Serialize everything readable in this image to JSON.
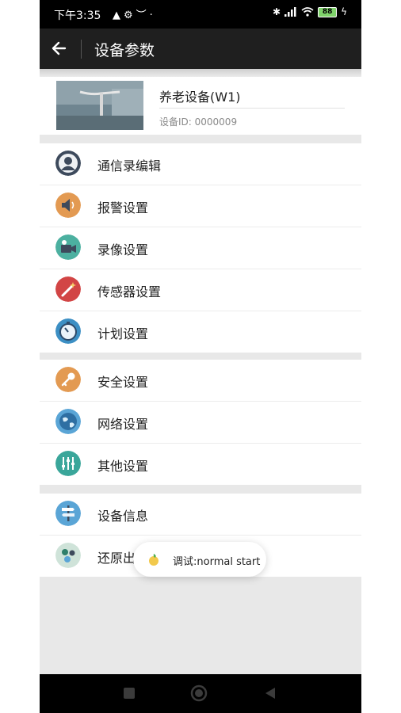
{
  "status_bar": {
    "time": "下午3:35",
    "battery": "88"
  },
  "toolbar": {
    "title": "设备参数"
  },
  "device": {
    "name": "养老设备(W1)",
    "id_label": "设备ID: 0000009"
  },
  "menu_groups": [
    [
      {
        "label": "通信录编辑",
        "icon": "contacts-icon",
        "color": "#3d4a5c"
      },
      {
        "label": "报警设置",
        "icon": "speaker-icon",
        "color": "#e39a52"
      },
      {
        "label": "录像设置",
        "icon": "video-camera-icon",
        "color": "#4cb0a0"
      },
      {
        "label": "传感器设置",
        "icon": "magic-wand-icon",
        "color": "#d24545"
      },
      {
        "label": "计划设置",
        "icon": "timer-icon",
        "color": "#3c8fc4"
      }
    ],
    [
      {
        "label": "安全设置",
        "icon": "key-icon",
        "color": "#e39a52"
      },
      {
        "label": "网络设置",
        "icon": "globe-icon",
        "color": "#5aa5d6"
      },
      {
        "label": "其他设置",
        "icon": "sliders-icon",
        "color": "#3aa69a"
      }
    ],
    [
      {
        "label": "设备信息",
        "icon": "signpost-icon",
        "color": "#5aa5d6"
      },
      {
        "label": "还原出",
        "icon": "restore-icon",
        "color": "#cfe3d9"
      }
    ]
  ],
  "toast": {
    "message": "调试:normal start"
  }
}
